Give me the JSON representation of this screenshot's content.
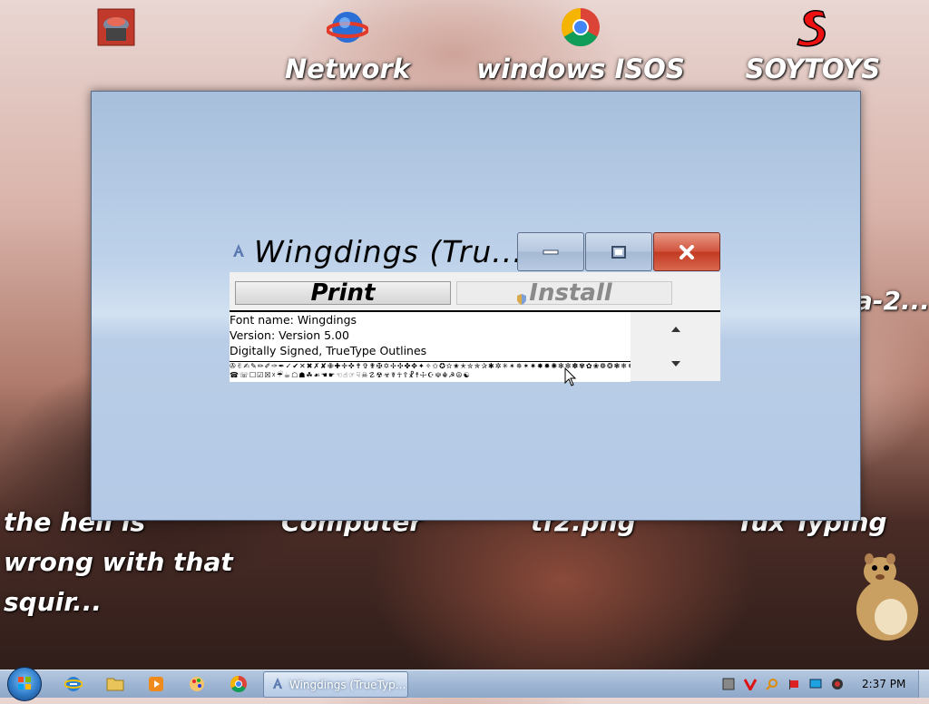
{
  "desktop": {
    "icons": [
      {
        "label": "",
        "icon": "app-icon"
      },
      {
        "label": "Network",
        "icon": "network-icon"
      },
      {
        "label": "windows ISOS",
        "icon": "chrome-icon"
      },
      {
        "label": "SOYTOYS",
        "icon": "soytoys-icon"
      }
    ],
    "bottom_icons": [
      {
        "label": "the hell is wrong with that squir..."
      },
      {
        "label": "Computer"
      },
      {
        "label": "tf2.png"
      },
      {
        "label": "Tux Typing"
      }
    ],
    "partial_label_right": "a-2..."
  },
  "font_viewer": {
    "title": "Wingdings (Tru...",
    "print_label": "Print",
    "install_label": "Install",
    "info": {
      "font_name": "Font name: Wingdings",
      "version": "Version: Version 5.00",
      "type": "Digitally Signed, TrueType Outlines"
    },
    "sample_line1": "✇✌✍✎✏✐✑✒✓✔✕✖✗✘✙✚✛✜✝✞✟✠✡✢✣✤✥✦✧✩✪✫✬✭✮✯✰✱✲✳✴✵✶✷✸✹✺✻✼✽✾✿❀❁❂❃❄❅❆❇❈❉❊❋",
    "sample_line2": "☎☏☐☑☒☓☔☕☖☗☘☙☚☛☜☝☞☟☠☡☢☣☤☥☦☧☨☩☪☫☬☭☮☯"
  },
  "taskbar": {
    "active_task": "Wingdings (TrueTyp...",
    "clock": "2:37 PM"
  },
  "colors": {
    "close_red": "#c33a22",
    "window_blue": "#b3c9e5"
  }
}
